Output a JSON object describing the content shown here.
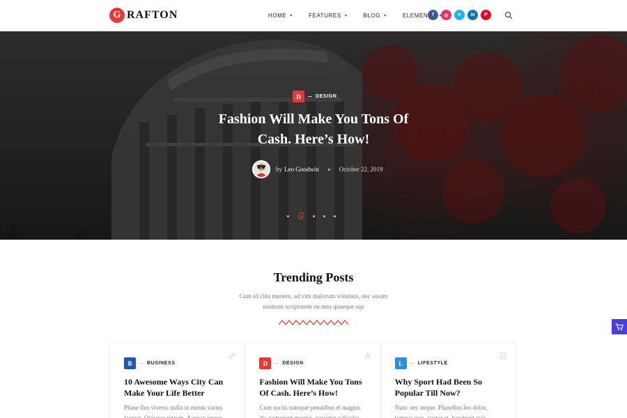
{
  "logo": {
    "badge": "G",
    "text": "RAFTON"
  },
  "nav": [
    {
      "label": "HOME",
      "caret": "▾"
    },
    {
      "label": "FEATURES",
      "caret": "▾"
    },
    {
      "label": "BLOG",
      "caret": "▾"
    },
    {
      "label": "ELEMENTS",
      "caret": "▾"
    }
  ],
  "socials": [
    {
      "name": "facebook-icon",
      "glyph": "f",
      "color": "#3b5998"
    },
    {
      "name": "instagram-icon",
      "glyph": "◎",
      "color": "#e1306c"
    },
    {
      "name": "vimeo-icon",
      "glyph": "v",
      "color": "#1ab7ea"
    },
    {
      "name": "linkedin-icon",
      "glyph": "in",
      "color": "#0077b5"
    },
    {
      "name": "pinterest-icon",
      "glyph": "P",
      "color": "#e60023"
    }
  ],
  "hero": {
    "category_badge": "D",
    "category": "DESIGN",
    "category_color": "#e53935",
    "title": "Fashion Will Make You Tons Of Cash. Here’s How!",
    "by": "by",
    "author": "Leo Goodwin",
    "date": "October 22, 2019",
    "slides": 5,
    "active_slide": 2
  },
  "trending": {
    "title": "Trending Posts",
    "subtitle": "Cum id clita munere, ad vim malorum volumus, nec assum nostrum scriptorem en mea quaeque sap",
    "accent_color": "#e53935"
  },
  "cards": [
    {
      "badge": "B",
      "category": "BUSINESS",
      "badge_color": "#1e5aa8",
      "title": "10 Awesome Ways City Can Make Your Life Better",
      "excerpt": "Phase llus viverra nulla ut metus varius laoreet. Quisque rutrum. Aenean imper",
      "type_icon": "pencil-icon"
    },
    {
      "badge": "D",
      "category": "DESIGN",
      "badge_color": "#e53935",
      "title": "Fashion Will Make You Tons Of Cash. Here’s How!",
      "excerpt": "Cum sociis natoque penatibus et magnis dis parturient montes, nascetur ridiculus",
      "type_icon": "font-icon"
    },
    {
      "badge": "L",
      "category": "LIFESTYLE",
      "badge_color": "#2e8fd8",
      "title": "Why Sport Had Been So Popular Till Now?",
      "excerpt": "Nunc nec neque. Phasellus leo dolor, tempus non, auctor et, hendrerit quis,",
      "type_icon": "image-icon"
    }
  ],
  "cart": {
    "icon": "cart-icon",
    "color": "#4a3fd8"
  }
}
